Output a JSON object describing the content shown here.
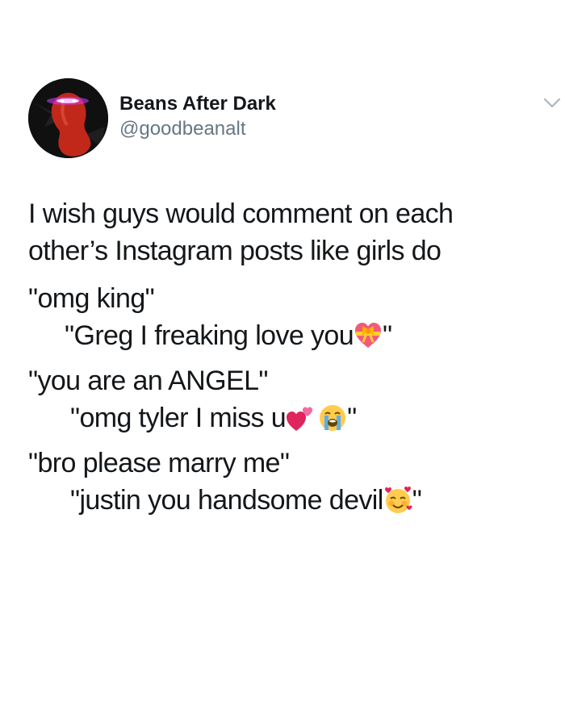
{
  "author": {
    "display_name": "Beans After Dark",
    "handle": "@goodbeanalt",
    "avatar_icon": "jellybean-laser-eyes-avatar"
  },
  "tweet": {
    "intro_line1": "I wish guys would comment on each",
    "intro_line2": "other’s Instagram posts like girls do",
    "q1": "\"omg king\"",
    "r1_text": "\"Greg I freaking love you",
    "r1_emoji": "heart-with-ribbon-icon",
    "r1_close": "\"",
    "q2": "\"you are an ANGEL\"",
    "r2_text": "\"omg tyler I miss u",
    "r2_emoji1": "two-hearts-icon",
    "r2_emoji2": "loudly-crying-face-icon",
    "r2_close": "\"",
    "q3": "\"bro please marry me\"",
    "r3_text": "\"justin you handsome devil",
    "r3_emoji": "smiling-face-with-hearts-icon",
    "r3_close": "\""
  },
  "colors": {
    "text": "#14171a",
    "handle": "#657786",
    "chevron": "#aab8c2",
    "avatar_bean": "#c1281a",
    "laser": "#d63cff"
  }
}
